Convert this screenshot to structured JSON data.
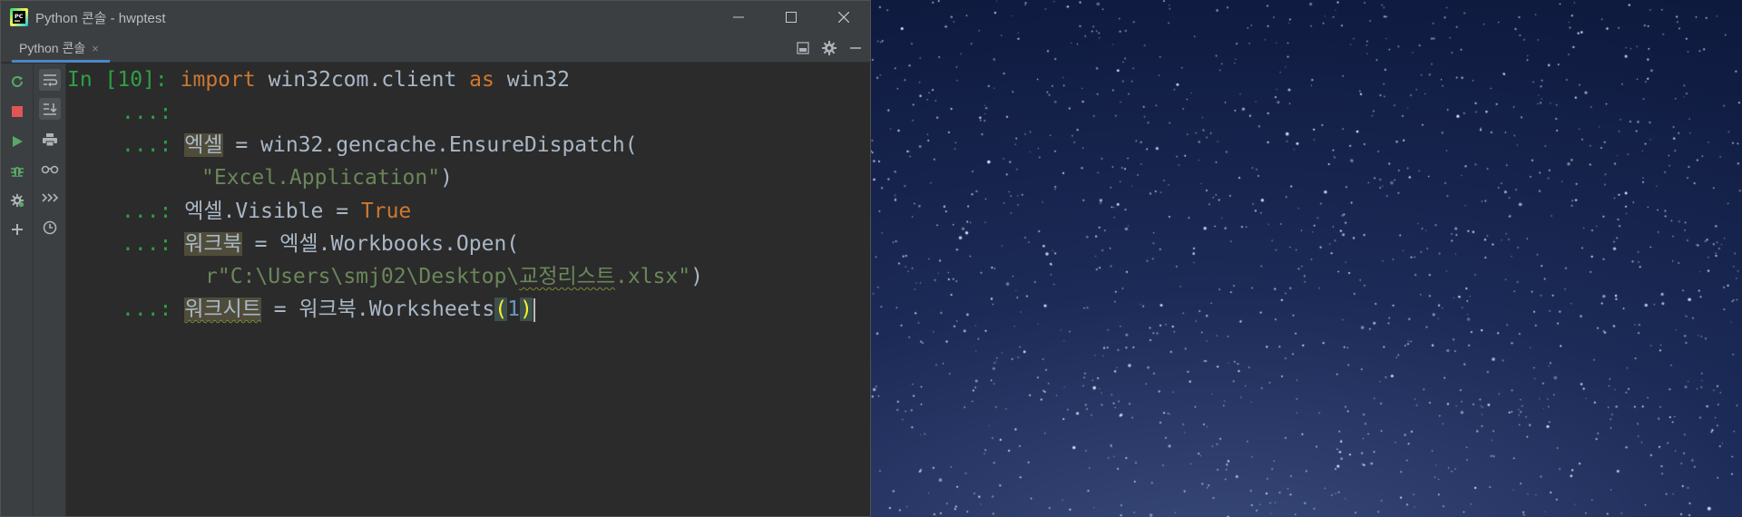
{
  "window": {
    "title": "Python 콘솔 - hwptest",
    "app_icon": "pycharm-icon"
  },
  "tab": {
    "label": "Python 콘솔",
    "close": "×"
  },
  "tab_actions": [
    "restore-layout-icon",
    "gear-icon",
    "minimize-panel-icon"
  ],
  "left_toolbar": [
    "rerun-icon",
    "stop-icon",
    "run-icon",
    "debug-icon",
    "settings-icon",
    "add-icon"
  ],
  "right_toolbar": [
    "soft-wrap-icon",
    "scroll-to-end-icon",
    "print-icon",
    "show-variables-icon",
    "execute-icon",
    "history-icon"
  ],
  "console": {
    "prompt_in": "In [10]:",
    "prompt_cont": "...:",
    "lines": {
      "l1_kw_import": "import",
      "l1_module": " win32com.client ",
      "l1_kw_as": "as",
      "l1_alias": " win32",
      "l3_var": "엑셀",
      "l3_rest": " = win32.gencache.EnsureDispatch(",
      "l4_str": "\"Excel.Application\"",
      "l4_close": ")",
      "l5_var": "엑셀.Visible = ",
      "l5_true": "True",
      "l6_var": "워크북",
      "l6_rest": " = 엑셀.Workbooks.Open(",
      "l7_str_a": "r\"C:\\Users\\smj02\\Desktop\\",
      "l7_str_b": "교정리스트",
      "l7_str_c": ".xlsx\"",
      "l7_close": ")",
      "l8_var": "워크시트",
      "l8_rest": " = 워크북.Worksheets",
      "l8_open": "(",
      "l8_num": "1",
      "l8_close": ")"
    }
  },
  "colors": {
    "keyword": "#cc7832",
    "string": "#6a8759",
    "prompt": "#2ea043",
    "text": "#a9b7c6",
    "background": "#2b2b2b"
  }
}
